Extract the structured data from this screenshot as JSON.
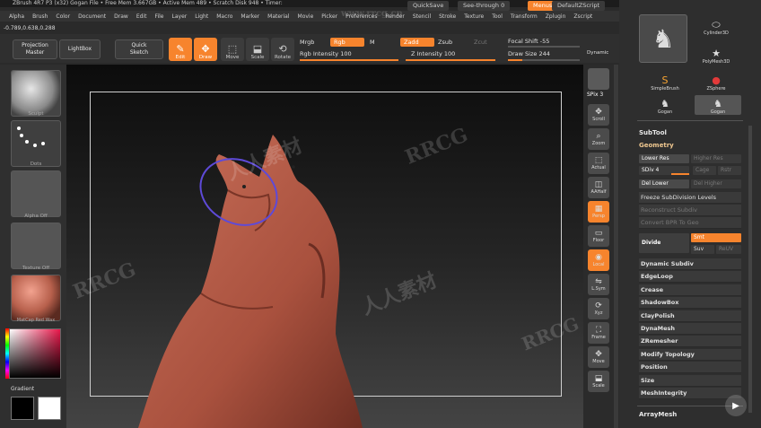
{
  "titlebar": {
    "text": "ZBrush 4R7 P3 (x32)   Gogan File   • Free Mem 3.667GB • Active Mem 489 • Scratch Disk 948 • Timer:"
  },
  "topbar": {
    "quicksave": "QuickSave",
    "seethrough": "See-through  0",
    "menus": "Menus",
    "script": "DefaultZScript"
  },
  "menubar": {
    "items": [
      "Alpha",
      "Brush",
      "Color",
      "Document",
      "Draw",
      "Edit",
      "File",
      "Layer",
      "Light",
      "Macro",
      "Marker",
      "Material",
      "Movie",
      "Picker",
      "Preferences",
      "Render",
      "Stencil",
      "Stroke",
      "Texture",
      "Tool",
      "Transform",
      "Zplugin",
      "Zscript"
    ]
  },
  "coords": "-0.789,0.638,0.288",
  "shelf": {
    "projection_master": "Projection\nMaster",
    "lightbox": "LightBox",
    "quick_sketch": "Quick\nSketch",
    "edit": "Edit",
    "draw": "Draw",
    "move": "Move",
    "scale": "Scale",
    "rotate": "Rotate",
    "mrgb": "Mrgb",
    "rgb": "Rgb",
    "m": "M",
    "rgb_intensity": "Rgb Intensity 100",
    "zadd": "Zadd",
    "zsub": "Zsub",
    "zcut": "Zcut",
    "z_intensity": "Z Intensity 100",
    "focal_shift": "Focal Shift -55",
    "draw_size": "Draw Size 244",
    "dynamic": "Dynamic"
  },
  "lefttray": {
    "brush_label": "Sculpt",
    "stroke_label": "Dots",
    "alpha_label": "Alpha Off",
    "texture_label": "Texture Off",
    "material_label": "MatCap Red Wax",
    "gradient_label": "Gradient"
  },
  "navstrip": {
    "spix": "SPix 3",
    "buttons": [
      "Scroll",
      "Zoom",
      "Actual",
      "AAHalf",
      "Persp",
      "Floor",
      "Local",
      "L.Sym",
      "Xyz",
      "Frame",
      "Move",
      "Scale"
    ]
  },
  "rpanel": {
    "tools": [
      "Cylinder3D",
      "PolyMesh3D",
      "SimpleBrush",
      "ZSphere",
      "Gogan",
      "Gogan"
    ],
    "subtool": "SubTool",
    "geometry": "Geometry",
    "lower_res": "Lower Res",
    "higher_res": "Higher Res",
    "sdiv": "SDiv 4",
    "cage": "Cage",
    "rstr": "Rstr",
    "del_lower": "Del Lower",
    "del_higher": "Del Higher",
    "freeze": "Freeze SubDivision Levels",
    "reconstruct": "Reconstruct Subdiv",
    "convert_bpr": "Convert BPR To Geo",
    "divide": "Divide",
    "smt": "Smt",
    "suv": "Suv",
    "reuv": "ReUV",
    "items": [
      "Dynamic Subdiv",
      "EdgeLoop",
      "Crease",
      "ShadowBox",
      "ClayPolish",
      "DynaMesh",
      "ZRemesher",
      "Modify Topology",
      "Position",
      "Size",
      "MeshIntegrity"
    ],
    "arraymesh": "ArrayMesh"
  },
  "watermarks": [
    "RRCG",
    "人人素材",
    "www.rrcg.cn"
  ],
  "colors": {
    "accent": "#f7842d",
    "clay": "#b7604c"
  }
}
